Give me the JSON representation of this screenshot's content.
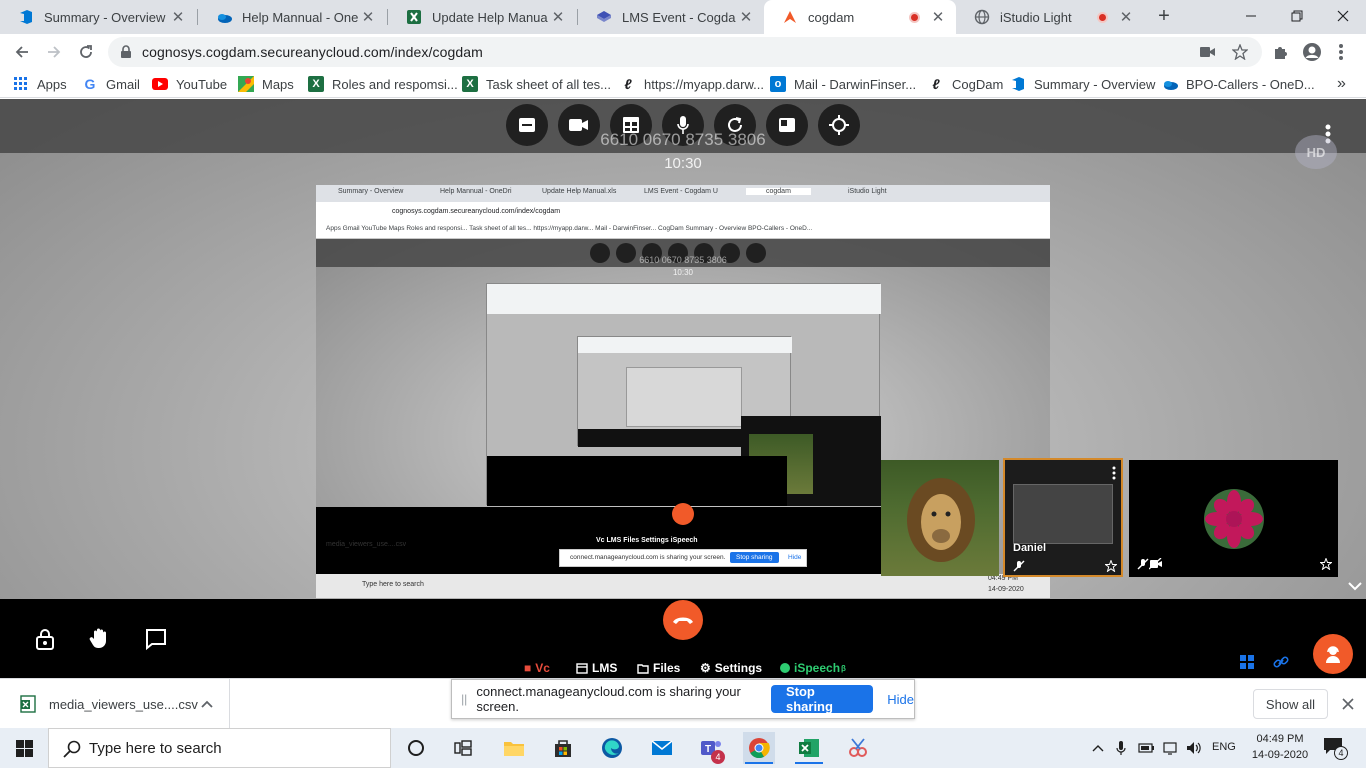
{
  "browser": {
    "tabs": [
      {
        "title": "Summary - Overview",
        "icon": "azure-devops-icon",
        "active": false
      },
      {
        "title": "Help Mannual - OneDri",
        "icon": "onedrive-icon",
        "active": false
      },
      {
        "title": "Update Help Manual.xls",
        "icon": "excel-icon",
        "active": false
      },
      {
        "title": "LMS Event - Cogdam U",
        "icon": "lms-icon",
        "active": false
      },
      {
        "title": "cogdam",
        "icon": "cogdam-icon",
        "active": true,
        "recording": true
      },
      {
        "title": "iStudio Light",
        "icon": "globe-icon",
        "active": false,
        "recording": true
      }
    ],
    "url": "cognosys.cogdam.secureanycloud.com/index/cogdam",
    "bookmarks": [
      {
        "label": "Apps",
        "icon": "apps-grid-icon"
      },
      {
        "label": "Gmail",
        "icon": "google-icon"
      },
      {
        "label": "YouTube",
        "icon": "youtube-icon"
      },
      {
        "label": "Maps",
        "icon": "maps-icon"
      },
      {
        "label": "Roles and respomsi...",
        "icon": "excel-icon"
      },
      {
        "label": "Task sheet of all tes...",
        "icon": "excel-icon"
      },
      {
        "label": "https://myapp.darw...",
        "icon": "link-icon"
      },
      {
        "label": "Mail - DarwinFinser...",
        "icon": "outlook-icon"
      },
      {
        "label": "CogDam",
        "icon": "link-icon"
      },
      {
        "label": "Summary - Overview",
        "icon": "azure-devops-icon"
      },
      {
        "label": "BPO-Callers - OneD...",
        "icon": "onedrive-icon"
      }
    ],
    "more_bookmarks": "»"
  },
  "conference": {
    "meeting_id": "6610 0670 8735 3806",
    "elapsed": "10:30",
    "quality_badge": "HD",
    "participant_name": "Daniel",
    "menu": [
      {
        "label": "Vc",
        "icon": "video-icon",
        "color": "#e74c3c"
      },
      {
        "label": "LMS",
        "icon": "calendar-icon",
        "color": "#ffffff"
      },
      {
        "label": "Files",
        "icon": "folder-icon",
        "color": "#ffffff"
      },
      {
        "label": "Settings",
        "icon": "settings-gear-icon",
        "color": "#ffffff"
      },
      {
        "label": "iSpeech",
        "icon": "status-dot-icon",
        "color": "#2ecc71",
        "superscript": "β"
      }
    ],
    "shared_preview": {
      "tabs": [
        "Summary - Overview",
        "Help Mannual - OneDri",
        "Update Help Manual.xls",
        "LMS Event - Cogdam U",
        "cogdam",
        "iStudio Light"
      ],
      "url": "cognosys.cogdam.secureanycloud.com/index/cogdam",
      "bookmarks": "Apps  Gmail  YouTube  Maps  Roles and responsi...  Task sheet of all tes...  https://myapp.darw...  Mail - DarwinFinser...  CogDam  Summary - Overview  BPO-Callers - OneD...",
      "meeting_id": "6610 0670 8735 3806",
      "elapsed": "10:30",
      "menu": "Vc   LMS   Files   Settings   iSpeech",
      "notify_text": "connect.manageanycloud.com is sharing your screen.",
      "stop": "Stop sharing",
      "hide": "Hide",
      "download": "media_viewers_use....csv",
      "search": "Type here to search",
      "time": "04:49 PM",
      "date": "14-09-2020"
    }
  },
  "share_notification": {
    "text": "connect.manageanycloud.com is sharing your screen.",
    "stop_label": "Stop sharing",
    "hide_label": "Hide"
  },
  "download_bar": {
    "file_name": "media_viewers_use....csv",
    "show_all": "Show all"
  },
  "taskbar": {
    "search_placeholder": "Type here to search",
    "apps": [
      "cortana-icon",
      "task-view-icon",
      "file-explorer-icon",
      "store-icon",
      "edge-icon",
      "mail-icon",
      "teams-icon",
      "chrome-icon",
      "excel-icon",
      "snipping-tool-icon"
    ],
    "teams_badge": "4",
    "language": "ENG",
    "time": "04:49 PM",
    "date": "14-09-2020",
    "notification_count": "4"
  },
  "colors": {
    "accent_orange": "#f15a29",
    "share_blue": "#1a73e8",
    "tile_border": "#d4892a"
  }
}
